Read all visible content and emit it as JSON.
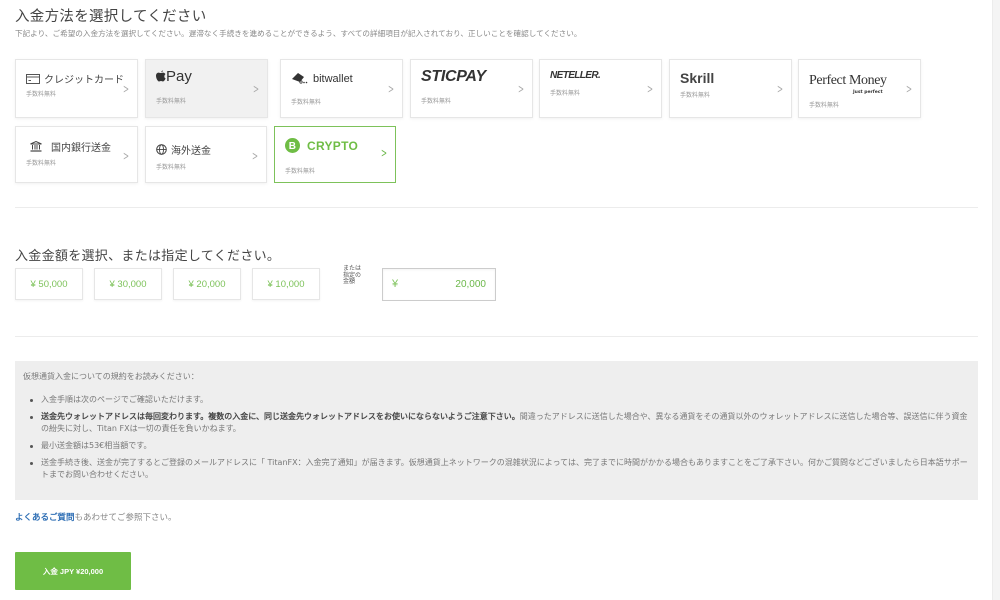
{
  "method_section": {
    "title": "入金方法を選択してください",
    "subtitle": "下記より、ご希望の入金方法を選択してください。遅滞なく手続きを進めることができるよう、すべての詳細項目が記入されており、正しいことを確認してください。",
    "fee_label": "手数料無料",
    "methods": [
      {
        "id": "credit-card",
        "label": "クレジットカード",
        "icon": "credit-card-icon",
        "fee": "手数料無料",
        "selected": false
      },
      {
        "id": "apple-pay",
        "label": "Pay",
        "icon": "apple-icon",
        "fee": "手数料無料",
        "selected": false
      },
      {
        "id": "bitwallet",
        "label": "bitwallet",
        "icon": "bitwallet-icon",
        "fee": "手数料無料",
        "selected": false
      },
      {
        "id": "sticpay",
        "label": "STICPAY",
        "icon": "",
        "fee": "手数料無料",
        "selected": false
      },
      {
        "id": "neteller",
        "label": "NETELLER.",
        "icon": "",
        "fee": "手数料無料",
        "selected": false
      },
      {
        "id": "skrill",
        "label": "Skrill",
        "icon": "",
        "fee": "手数料無料",
        "selected": false
      },
      {
        "id": "perfect-money",
        "label": "Perfect Money",
        "tagline": "Just perfect",
        "icon": "",
        "fee": "手数料無料",
        "selected": false
      },
      {
        "id": "domestic-bank",
        "label": "国内銀行送金",
        "icon": "bank-icon",
        "fee": "手数料無料",
        "selected": false
      },
      {
        "id": "international-wire",
        "label": "海外送金",
        "icon": "globe-icon",
        "fee": "手数料無料",
        "selected": false
      },
      {
        "id": "crypto",
        "label": "CRYPTO",
        "icon": "bitcoin-icon",
        "fee": "手数料無料",
        "selected": true
      }
    ]
  },
  "amount_section": {
    "title": "入金金額を選択、または指定してください。",
    "presets": [
      "¥ 50,000",
      "¥ 30,000",
      "¥ 20,000",
      "¥ 10,000"
    ],
    "custom_label": "または指定の金額",
    "custom_label_lines": [
      "または",
      "指定の",
      "金額"
    ],
    "currency_symbol": "¥",
    "custom_value": "20,000"
  },
  "terms": {
    "heading": "仮想通貨入金についての規約をお読みください：",
    "items": [
      {
        "bold": "",
        "text": "入金手順は次のページでご確認いただけます。"
      },
      {
        "bold": "送金先ウォレットアドレスは毎回変わります。複数の入金に、同じ送金先ウォレットアドレスをお使いにならないようご注意下さい。",
        "text": "間違ったアドレスに送信した場合や、異なる通貨をその通貨以外のウォレットアドレスに送信した場合等、誤送信に伴う資金の紛失に対し、Titan FXは一切の責任を負いかねます。"
      },
      {
        "bold": "",
        "text": "最小送金額は53€相当額です。"
      },
      {
        "bold": "",
        "text": "送金手続き後、送金が完了するとご登録のメールアドレスに「 TitanFX：入金完了通知」が届きます。仮想通貨上ネットワークの混雑状況によっては、完了までに時間がかかる場合もありますことをご了承下さい。何かご質問などございましたら日本語サポートまでお問い合わせください。"
      }
    ]
  },
  "faq": {
    "link_text": "よくあるご質問",
    "suffix": "もあわせてご参照下さい。"
  },
  "submit": {
    "label": "入金 JPY ¥20,000"
  },
  "colors": {
    "accent_green": "#6fbd45",
    "link_blue": "#2f6fb5"
  }
}
